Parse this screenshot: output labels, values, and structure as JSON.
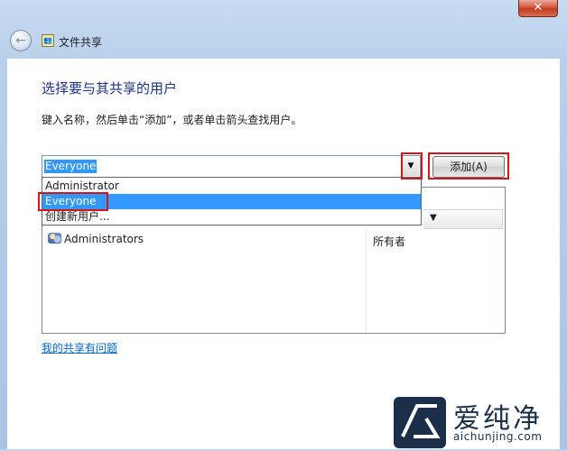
{
  "window": {
    "title": "文件共享",
    "close_label": "✕"
  },
  "page": {
    "heading": "选择要与其共享的用户",
    "instruction": "键入名称，然后单击“添加”，或者单击箭头查找用户。"
  },
  "user_input": {
    "value": "Everyone",
    "arrow_glyph": "▼"
  },
  "add_button": {
    "label": "添加(A)"
  },
  "dropdown": {
    "items": [
      {
        "label": "Administrator"
      },
      {
        "label": "Everyone",
        "selected": true
      },
      {
        "label": "创建新用户..."
      }
    ]
  },
  "table": {
    "header_arrow": "▼",
    "rows": [
      {
        "name": "Administrators",
        "permission": "所有者"
      }
    ]
  },
  "help_link": "我的共享有问题",
  "watermark": {
    "brand": "爱纯净",
    "domain": "aichunjing.com"
  },
  "colors": {
    "highlight": "#d2161b",
    "selection": "#3399ff",
    "link": "#0066cc",
    "heading": "#1e3287"
  }
}
